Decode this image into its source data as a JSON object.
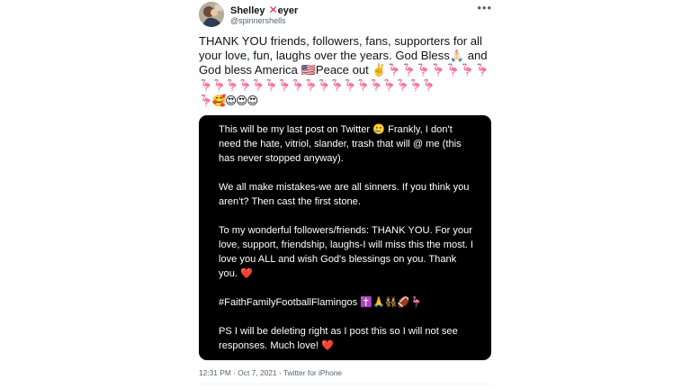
{
  "tweet": {
    "author": {
      "name": "Shelley",
      "name_x": "✕",
      "name_rest": "eyer",
      "handle": "@spinnershells"
    },
    "more_label": "•••",
    "text": "THANK YOU friends, followers, fans, supporters for all your love, fun, laughs over the years. God Bless🙏🏻 and God bless America 🇺🇸Peace out ✌️🦩🦩🦩🦩🦩🦩🦩",
    "emoji_line": "🦩🦩🦩🦩🦩🦩🦩🦩🦩🦩🦩🦩🦩🦩🦩🦩🦩🦩\n🦩🥰😍😍😍",
    "image_text": "This will be my last post on Twitter 🥲 Frankly, I don't need the hate, vitriol, slander, trash that will @ me (this has never stopped anyway).\n\nWe all make mistakes-we are all sinners. If you think you aren't? Then cast the first stone.\n\nTo my wonderful followers/friends: THANK YOU. For your love, support, friendship, laughs-I will miss this the most. I love you ALL and wish God's blessings on you. Thank you. ❤️\n\n#FaithFamilyFootballFlamingos ✝️🙏👯‍♀️🏈🦩\n\nPS I will be deleting right as I post this so I will not see responses. Much love! ❤️",
    "timestamp": "12:31 PM · Oct 7, 2021 · Twitter for iPhone"
  },
  "colors": {
    "text": "#0f1419",
    "secondary": "#536471",
    "x_mark": "#e0245e",
    "card_bg": "#000000"
  }
}
